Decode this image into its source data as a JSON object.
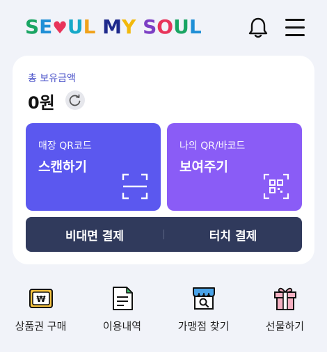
{
  "header": {
    "logo": {
      "letters": [
        {
          "ch": "S",
          "color": "#1aa563"
        },
        {
          "ch": "E",
          "color": "#1f8fd6"
        },
        {
          "ch": "♥",
          "color": "#e8345a"
        },
        {
          "ch": "U",
          "color": "#16a9c8"
        },
        {
          "ch": "L",
          "color": "#f0a21a"
        },
        {
          "ch": " ",
          "color": "#111111"
        },
        {
          "ch": "M",
          "color": "#1f2a8c"
        },
        {
          "ch": "Y",
          "color": "#f2b90c"
        },
        {
          "ch": " ",
          "color": "#111111"
        },
        {
          "ch": "S",
          "color": "#7c3fc4"
        },
        {
          "ch": "O",
          "color": "#e8345a"
        },
        {
          "ch": "U",
          "color": "#1aa563"
        },
        {
          "ch": "L",
          "color": "#1f8fd6"
        }
      ]
    },
    "icons": {
      "notifications": "bell-icon",
      "menu": "hamburger-menu-icon"
    }
  },
  "balance": {
    "label": "총 보유금액",
    "value": "0원",
    "refresh_icon": "refresh-icon"
  },
  "tiles": {
    "scan": {
      "sub": "매장 QR코드",
      "main": "스캔하기",
      "icon": "scan-frame-icon",
      "color": "#5b58ef"
    },
    "show": {
      "sub": "나의 QR/바코드",
      "main": "보여주기",
      "icon": "qr-code-icon",
      "color": "#8a5cf6"
    }
  },
  "payments": {
    "contactless": "비대면 결제",
    "touch": "터치 결제",
    "color": "#303a5c"
  },
  "quick_menu": [
    {
      "label": "상품권 구매",
      "icon": "voucher-won-icon"
    },
    {
      "label": "이용내역",
      "icon": "document-list-icon"
    },
    {
      "label": "가맹점 찾기",
      "icon": "store-search-icon"
    },
    {
      "label": "선물하기",
      "icon": "gift-icon"
    }
  ]
}
